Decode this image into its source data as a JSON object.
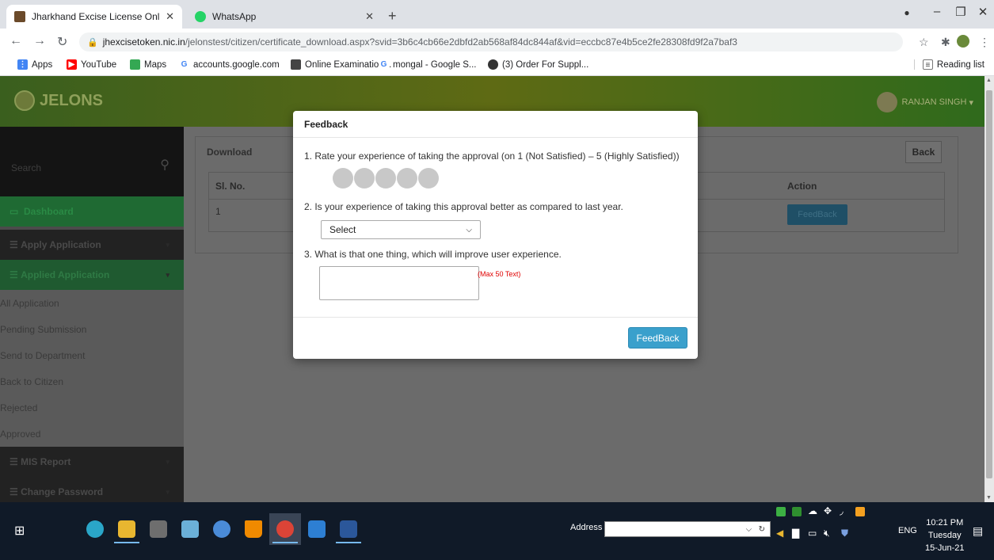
{
  "browser": {
    "tabs": [
      {
        "title": "Jharkhand Excise License Online",
        "active": true
      },
      {
        "title": "WhatsApp",
        "active": false
      }
    ],
    "new_tab_icon": "plus-icon",
    "url_host": "jhexcisetoken.nic.in",
    "url_path": "/jelonstest/citizen/certificate_download.aspx?svid=3b6c4cb66e2dbfd2ab568af84dc844af&vid=eccbc87e4b5ce2fe28308fd9f2a7baf3",
    "bookmarks": [
      "Apps",
      "YouTube",
      "Maps",
      "accounts.google.com",
      "Online Examination...",
      "mongal - Google S...",
      "(3) Order For Suppl..."
    ],
    "reading_list": "Reading list"
  },
  "site": {
    "logo_text": "JELONS",
    "user_name": "RANJAN SINGH"
  },
  "sidebar": {
    "search_placeholder": "Search",
    "items": [
      {
        "label": "Dashboard"
      },
      {
        "label": "Apply Application"
      },
      {
        "label": "Applied Application"
      },
      {
        "label": "MIS Report"
      },
      {
        "label": "Change Password"
      }
    ],
    "subitems": [
      "All Application",
      "Pending Submission",
      "Send to Department",
      "Back to Citizen",
      "Rejected",
      "Approved"
    ]
  },
  "main": {
    "title": "Download",
    "back_label": "Back",
    "columns": [
      "Sl. No.",
      "Action"
    ],
    "rows": [
      {
        "sl": "1",
        "action": "FeedBack"
      }
    ]
  },
  "modal": {
    "title": "Feedback",
    "q1": "1. Rate your experience of taking the approval (on 1 (Not Satisfied) – 5 (Highly Satisfied))",
    "rating_max": 5,
    "rating_value": 0,
    "q2": "2. Is your experience of taking this approval better as compared to last year.",
    "select_value": "Select",
    "q3": "3. What is that one thing, which will improve user experience.",
    "textarea_value": "",
    "max_hint": "(Max 50 Text)",
    "submit_label": "FeedBack"
  },
  "taskbar": {
    "address_label": "Address",
    "language": "ENG",
    "time": "10:21 PM",
    "day": "Tuesday",
    "date": "15-Jun-21"
  },
  "colors": {
    "accent_button": "#3aa0cc",
    "max_hint": "#e00000",
    "header_green": "#3a5f1e"
  }
}
